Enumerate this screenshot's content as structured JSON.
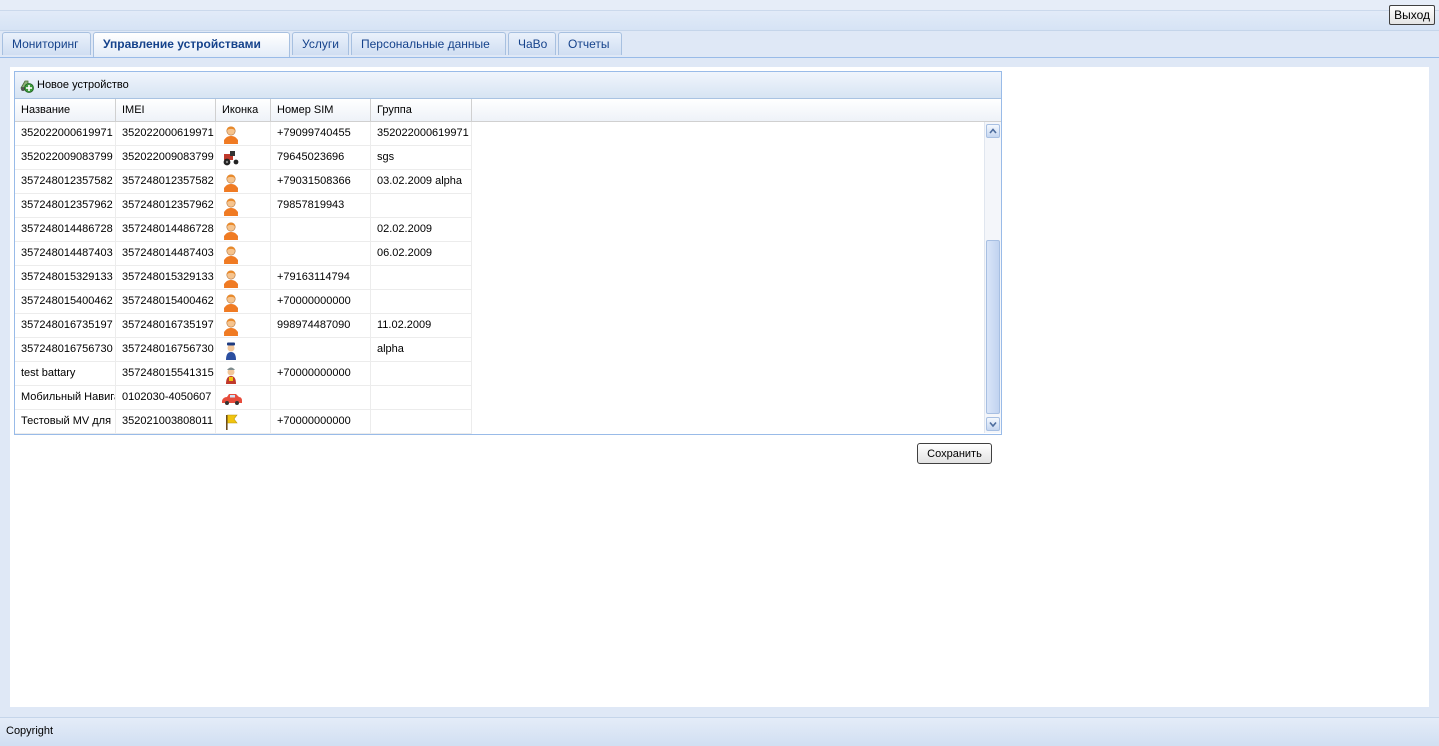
{
  "header": {
    "exit_label": "Выход"
  },
  "tabs": [
    {
      "label": "Мониторинг",
      "active": false
    },
    {
      "label": "Управление устройствами",
      "active": true
    },
    {
      "label": "Услуги",
      "active": false
    },
    {
      "label": "Персональные данные",
      "active": false
    },
    {
      "label": "ЧаВо",
      "active": false
    },
    {
      "label": "Отчеты",
      "active": false
    }
  ],
  "grid": {
    "toolbar": {
      "new_device_label": "Новое устройство",
      "new_device_icon": "add-device-icon"
    },
    "columns": [
      "Название",
      "IMEI",
      "Иконка",
      "Номер SIM",
      "Группа"
    ],
    "rows": [
      {
        "name": "352022000619971",
        "imei": "352022000619971",
        "icon": "person-icon",
        "sim": "+79099740455",
        "group": "352022000619971"
      },
      {
        "name": "352022009083799",
        "imei": "352022009083799",
        "icon": "tractor-icon",
        "sim": "79645023696",
        "group": "sgs"
      },
      {
        "name": "357248012357582",
        "imei": "357248012357582",
        "icon": "person-icon",
        "sim": "+79031508366",
        "group": "03.02.2009 alpha"
      },
      {
        "name": "357248012357962",
        "imei": "357248012357962",
        "icon": "person-icon",
        "sim": "79857819943",
        "group": ""
      },
      {
        "name": "357248014486728",
        "imei": "357248014486728",
        "icon": "person-icon",
        "sim": "",
        "group": "02.02.2009"
      },
      {
        "name": "357248014487403",
        "imei": "357248014487403",
        "icon": "person-icon",
        "sim": "",
        "group": "06.02.2009"
      },
      {
        "name": "357248015329133",
        "imei": "357248015329133",
        "icon": "person-icon",
        "sim": "+79163114794",
        "group": ""
      },
      {
        "name": "357248015400462",
        "imei": "357248015400462",
        "icon": "person-icon",
        "sim": "+70000000000",
        "group": ""
      },
      {
        "name": "357248016735197",
        "imei": "357248016735197",
        "icon": "person-icon",
        "sim": "998974487090",
        "group": "11.02.2009"
      },
      {
        "name": "357248016756730",
        "imei": "357248016756730",
        "icon": "policeman-icon",
        "sim": "",
        "group": "alpha"
      },
      {
        "name": "test battary",
        "imei": "357248015541315",
        "icon": "worker-icon",
        "sim": "+70000000000",
        "group": ""
      },
      {
        "name": "Мобильный Навигатор",
        "imei": "0102030-4050607",
        "icon": "car-icon",
        "sim": "",
        "group": ""
      },
      {
        "name": "Тестовый MV для",
        "imei": "352021003808011",
        "icon": "flag-icon",
        "sim": "+70000000000",
        "group": ""
      }
    ],
    "save_label": "Сохранить"
  },
  "footer": {
    "copyright": "Copyright"
  },
  "colors": {
    "accent": "#15428b",
    "border": "#99bbe8",
    "background": "#dfe8f6"
  }
}
